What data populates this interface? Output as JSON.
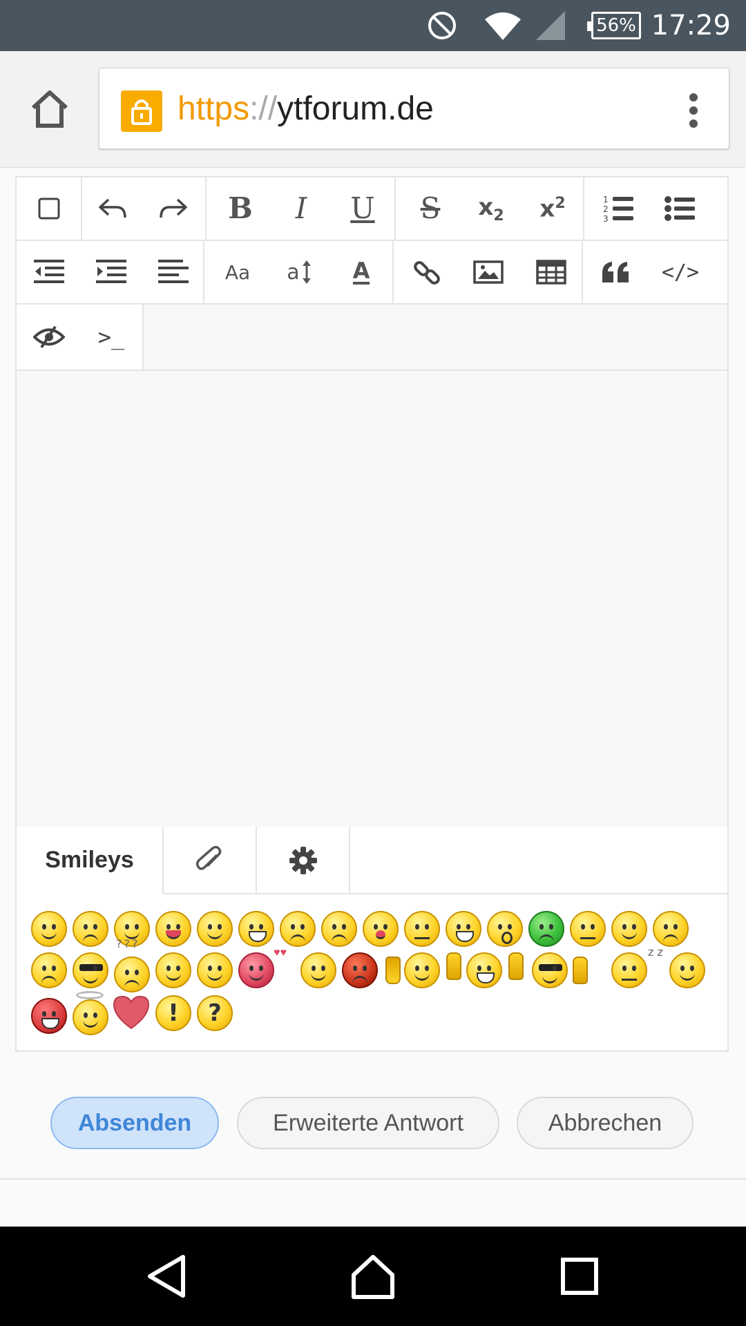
{
  "status_bar": {
    "time": "17:29",
    "battery": "56%",
    "icons": [
      "do-not-disturb-icon",
      "wifi-icon",
      "cell-signal-icon",
      "battery-icon"
    ]
  },
  "browser": {
    "url_scheme": "https",
    "url_separator": "://",
    "url_host": "ytforum.de",
    "icons": [
      "home-icon",
      "lock-icon",
      "overflow-menu-icon"
    ]
  },
  "editor": {
    "toolbar_row1": [
      "checkbox-icon",
      "undo-icon",
      "redo-icon",
      "bold-icon",
      "italic-icon",
      "underline-icon",
      "strikethrough-icon",
      "subscript-icon",
      "superscript-icon",
      "ordered-list-icon",
      "unordered-list-icon"
    ],
    "toolbar_row2": [
      "outdent-icon",
      "indent-icon",
      "align-left-icon",
      "font-family-icon",
      "font-size-icon",
      "text-color-icon",
      "link-icon",
      "image-icon",
      "table-icon",
      "quote-icon",
      "code-icon"
    ],
    "toolbar_row3": [
      "preview-icon",
      "terminal-icon"
    ],
    "labels": {
      "bold": "B",
      "italic": "I",
      "underline": "U",
      "strike": "S",
      "font_family": "Aa",
      "font_size": "a",
      "text_color": "A",
      "subscript_base": "x",
      "subscript_sub": "2",
      "superscript_base": "x",
      "superscript_sup": "2",
      "ordered_1": "1",
      "ordered_2": "2",
      "ordered_3": "3",
      "terminal": ">_",
      "code": "</>"
    },
    "tabs": {
      "smileys": "Smileys",
      "attachments_icon": "paperclip-icon",
      "settings_icon": "gear-icon"
    },
    "smileys": {
      "qmarks": "???",
      "zz": "z z",
      "exclaim": "!",
      "question": "?"
    }
  },
  "actions": {
    "submit": "Absenden",
    "extended": "Erweiterte Antwort",
    "cancel": "Abbrechen"
  },
  "nav": {
    "icons": [
      "back-icon",
      "home-icon",
      "recents-icon"
    ]
  },
  "colors": {
    "status_bar": "#4a565f",
    "url_scheme": "#f29900",
    "lock_badge": "#f9ab00",
    "submit_bg": "#cfe3fb",
    "submit_text": "#3f86d6"
  }
}
